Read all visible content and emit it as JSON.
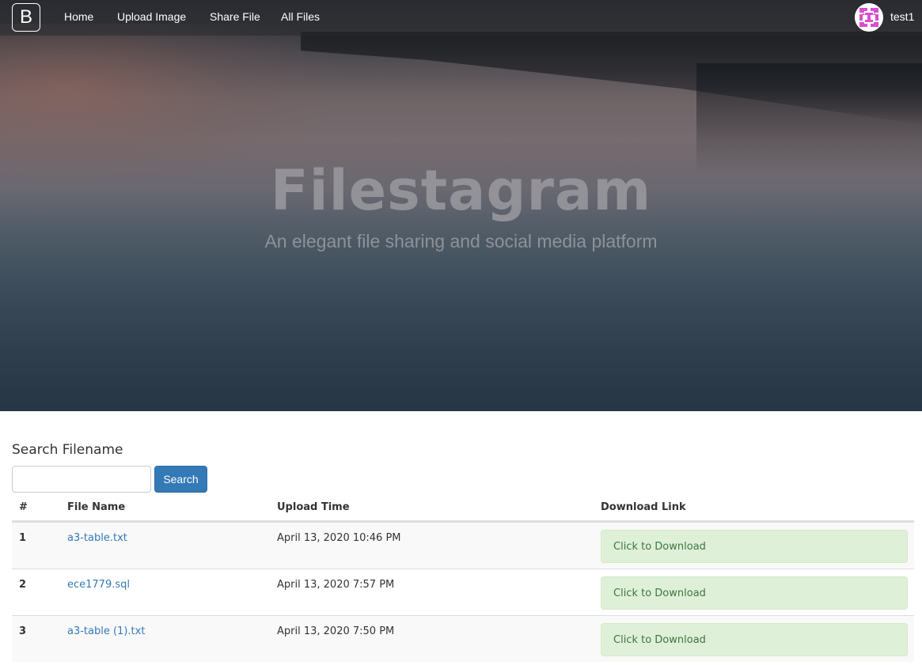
{
  "navbar": {
    "brand_letter": "B",
    "links": [
      "Home",
      "Upload Image",
      "Share File",
      "All Files"
    ],
    "username": "test1"
  },
  "hero": {
    "title": "Filestagram",
    "subtitle": "An elegant file sharing and social media platform"
  },
  "search": {
    "heading": "Search Filename",
    "input_value": "",
    "button_label": "Search"
  },
  "table": {
    "headers": [
      "#",
      "File Name",
      "Upload Time",
      "Download Link"
    ],
    "rows": [
      {
        "num": "1",
        "name": "a3-table.txt",
        "time": "April 13, 2020 10:46 PM",
        "link": "Click to Download"
      },
      {
        "num": "2",
        "name": "ece1779.sql",
        "time": "April 13, 2020 7:57 PM",
        "link": "Click to Download"
      },
      {
        "num": "3",
        "name": "a3-table (1).txt",
        "time": "April 13, 2020 7:50 PM",
        "link": "Click to Download"
      }
    ]
  },
  "colors": {
    "primary": "#337ab7",
    "success_bg": "#dff0d8",
    "success_text": "#3c763d",
    "avatar_accent": "#d84fcf"
  },
  "icons": {
    "avatar": "identicon-avatar"
  }
}
